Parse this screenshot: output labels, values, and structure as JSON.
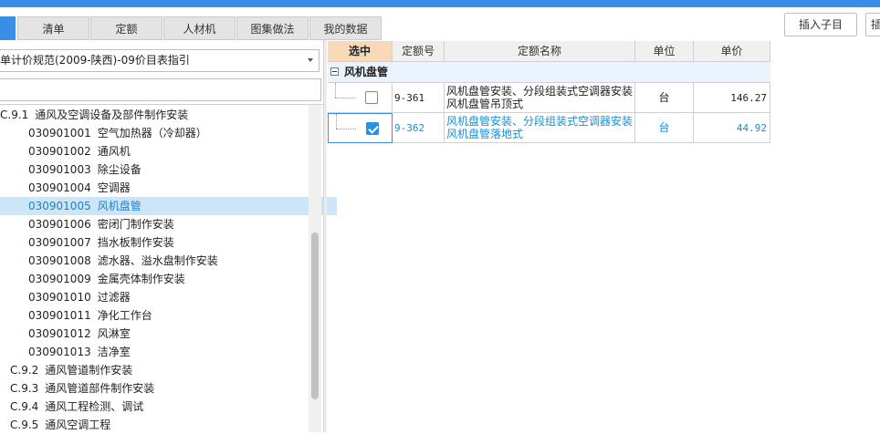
{
  "tabs": [
    {
      "label": "",
      "active": true
    },
    {
      "label": "清单",
      "active": false
    },
    {
      "label": "定额",
      "active": false
    },
    {
      "label": "人材机",
      "active": false
    },
    {
      "label": "图集做法",
      "active": false
    },
    {
      "label": "我的数据",
      "active": false
    }
  ],
  "toolbar": {
    "insert_child": "插入子目",
    "insert_cut": "插"
  },
  "left": {
    "select_value": "单计价规范(2009-陕西)-09价目表指引",
    "search_placeholder": "",
    "tree": [
      {
        "code": "C.9.1",
        "label": "通风及空调设备及部件制作安装",
        "level": 0,
        "selected": false
      },
      {
        "code": "030901001",
        "label": "空气加热器（冷却器）",
        "level": 1,
        "selected": false
      },
      {
        "code": "030901002",
        "label": "通风机",
        "level": 1,
        "selected": false
      },
      {
        "code": "030901003",
        "label": "除尘设备",
        "level": 1,
        "selected": false
      },
      {
        "code": "030901004",
        "label": "空调器",
        "level": 1,
        "selected": false
      },
      {
        "code": "030901005",
        "label": "风机盘管",
        "level": 1,
        "selected": true
      },
      {
        "code": "030901006",
        "label": "密闭门制作安装",
        "level": 1,
        "selected": false
      },
      {
        "code": "030901007",
        "label": "挡水板制作安装",
        "level": 1,
        "selected": false
      },
      {
        "code": "030901008",
        "label": "滤水器、溢水盘制作安装",
        "level": 1,
        "selected": false
      },
      {
        "code": "030901009",
        "label": "金属壳体制作安装",
        "level": 1,
        "selected": false
      },
      {
        "code": "030901010",
        "label": "过滤器",
        "level": 1,
        "selected": false
      },
      {
        "code": "030901011",
        "label": "净化工作台",
        "level": 1,
        "selected": false
      },
      {
        "code": "030901012",
        "label": "风淋室",
        "level": 1,
        "selected": false
      },
      {
        "code": "030901013",
        "label": "洁净室",
        "level": 1,
        "selected": false
      },
      {
        "code": "C.9.2",
        "label": "通风管道制作安装",
        "level": 0,
        "selected": false
      },
      {
        "code": "C.9.3",
        "label": "通风管道部件制作安装",
        "level": 0,
        "selected": false
      },
      {
        "code": "C.9.4",
        "label": "通风工程检测、调试",
        "level": 0,
        "selected": false
      },
      {
        "code": "C.9.5",
        "label": "通风空调工程",
        "level": 0,
        "selected": false
      }
    ]
  },
  "grid": {
    "headers": [
      "选中",
      "定额号",
      "定额名称",
      "单位",
      "单价"
    ],
    "group_label": "风机盘管",
    "rows": [
      {
        "checked": false,
        "code": "9-361",
        "name_line1": "风机盘管安装、分段组装式空调器安装",
        "name_line2": "风机盘管吊顶式",
        "unit": "台",
        "price": "146.27"
      },
      {
        "checked": true,
        "code": "9-362",
        "name_line1": "风机盘管安装、分段组装式空调器安装",
        "name_line2": "风机盘管落地式",
        "unit": "台",
        "price": "44.92"
      }
    ]
  }
}
